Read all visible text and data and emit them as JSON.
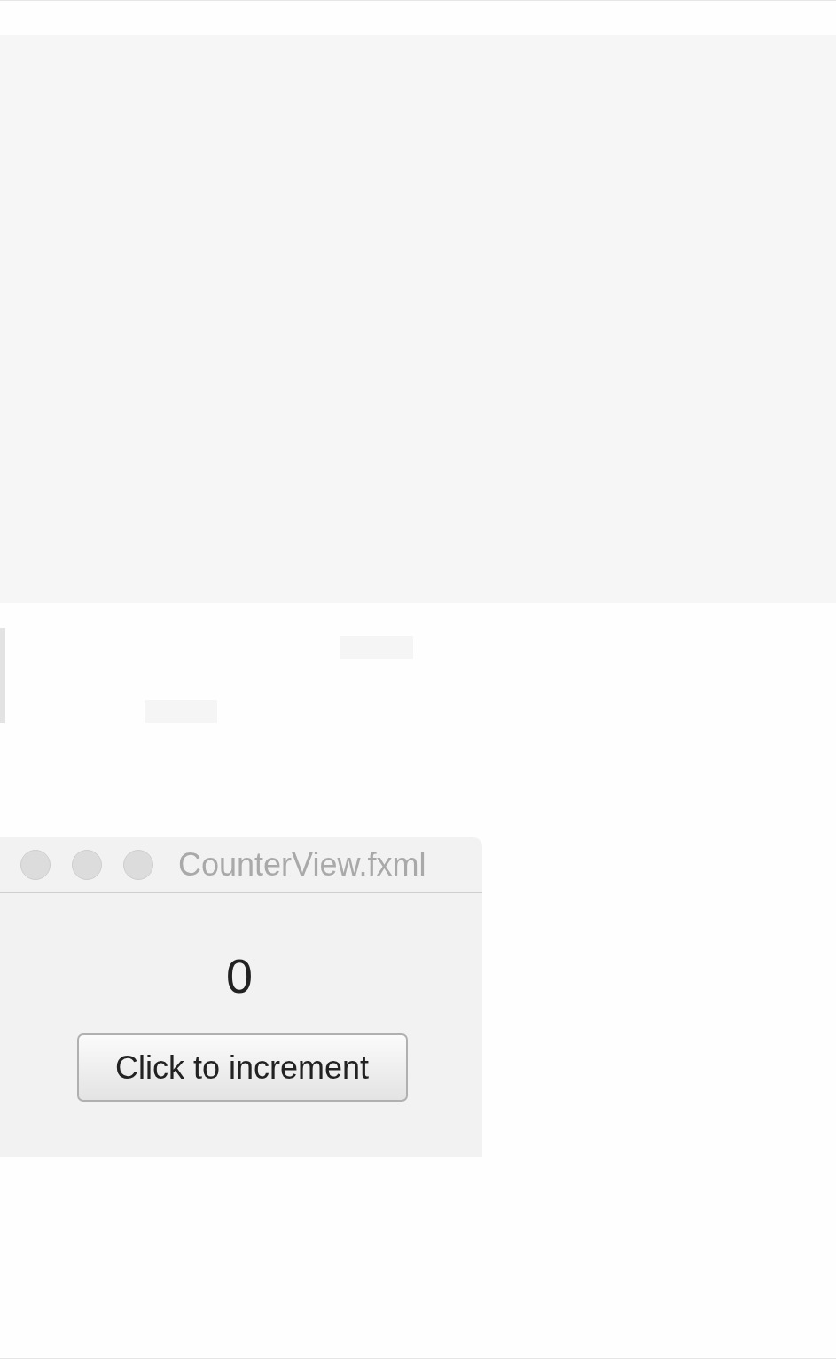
{
  "window": {
    "title": "CounterView.fxml",
    "active": false
  },
  "counter": {
    "value": "0"
  },
  "button": {
    "label": "Click to increment"
  }
}
